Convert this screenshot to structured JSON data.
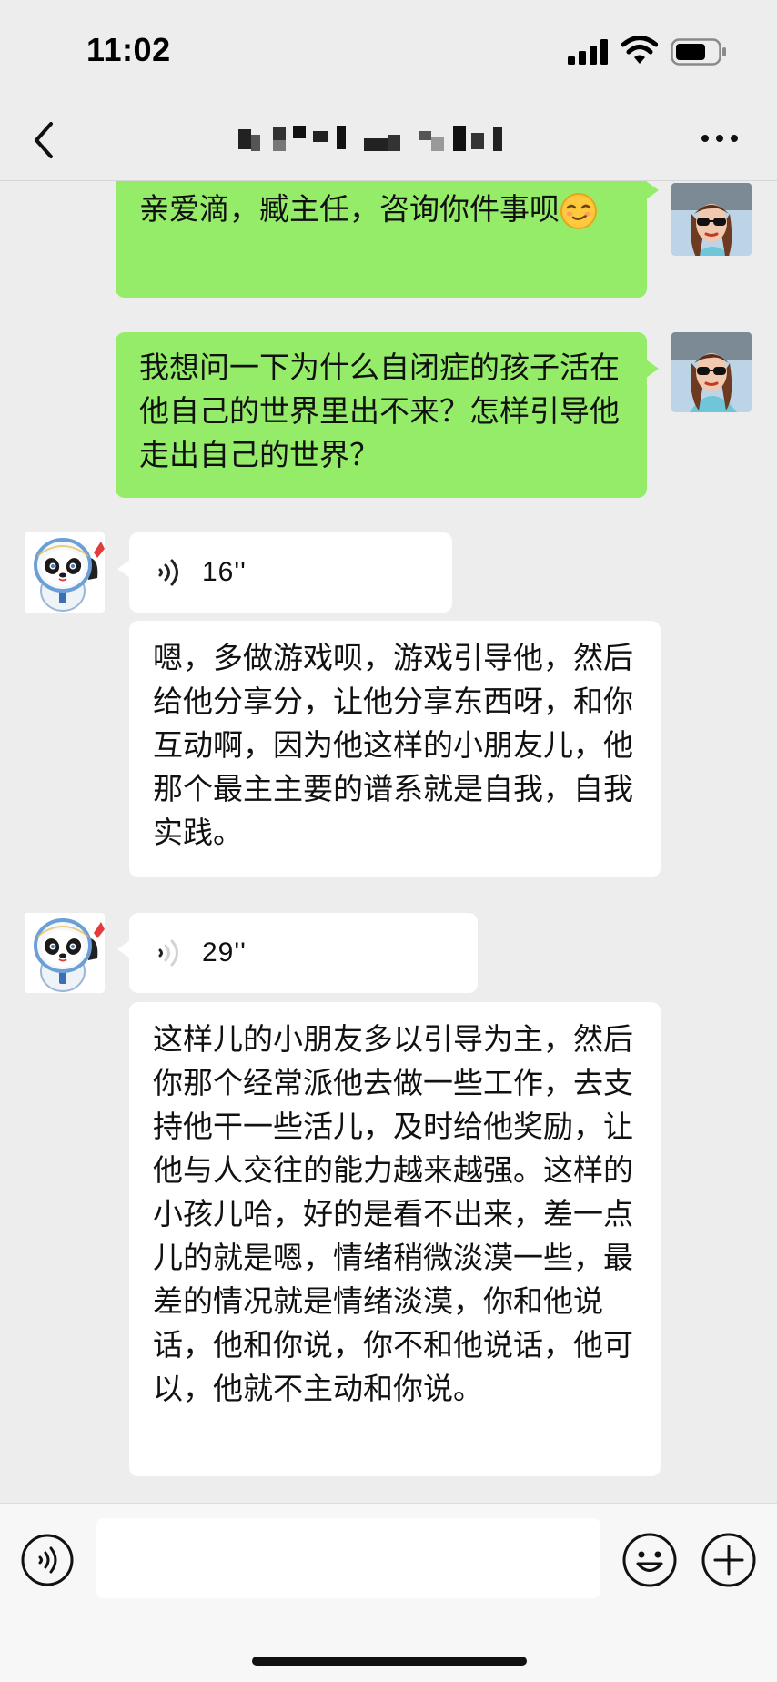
{
  "status_bar": {
    "time": "11:02"
  },
  "nav": {
    "back_icon": "chevron-left-icon",
    "title": "",
    "title_redacted": true,
    "more_icon": "more-dots-icon"
  },
  "messages": [
    {
      "type": "text",
      "direction": "sent",
      "text": "亲爱滴，臧主任，咨询你件事呗",
      "emoji": "smirk-emoji"
    },
    {
      "type": "text",
      "direction": "sent",
      "text": "我想问一下为什么自闭症的孩子活在他自己的世界里出不来？怎样引导他走出自己的世界？"
    },
    {
      "type": "voice",
      "direction": "received",
      "duration": "16''"
    },
    {
      "type": "text",
      "direction": "received",
      "text": "嗯，多做游戏呗，游戏引导他，然后给他分享分，让他分享东西呀，和你互动啊，因为他这样的小朋友儿，他那个最主主要的谱系就是自我，自我实践。"
    },
    {
      "type": "voice",
      "direction": "received",
      "duration": "29''"
    },
    {
      "type": "text",
      "direction": "received",
      "text": "这样儿的小朋友多以引导为主，然后你那个经常派他去做一些工作，去支持他干一些活儿，及时给他奖励，让他与人交往的能力越来越强。这样的小孩儿哈，好的是看不出来，差一点儿的就是嗯，情绪稍微淡漠一些，最差的情况就是情绪淡漠，你和他说话，他和你说，你不和他说话，他可以，他就不主动和你说。"
    }
  ],
  "input_bar": {
    "placeholder": "",
    "voice_icon": "voice-input-icon",
    "emoji_icon": "emoji-smile-icon",
    "add_icon": "plus-circle-icon"
  },
  "colors": {
    "background": "#ededed",
    "sent_bubble": "#95ec69",
    "received_bubble": "#ffffff",
    "input_bar": "#f7f7f7"
  }
}
